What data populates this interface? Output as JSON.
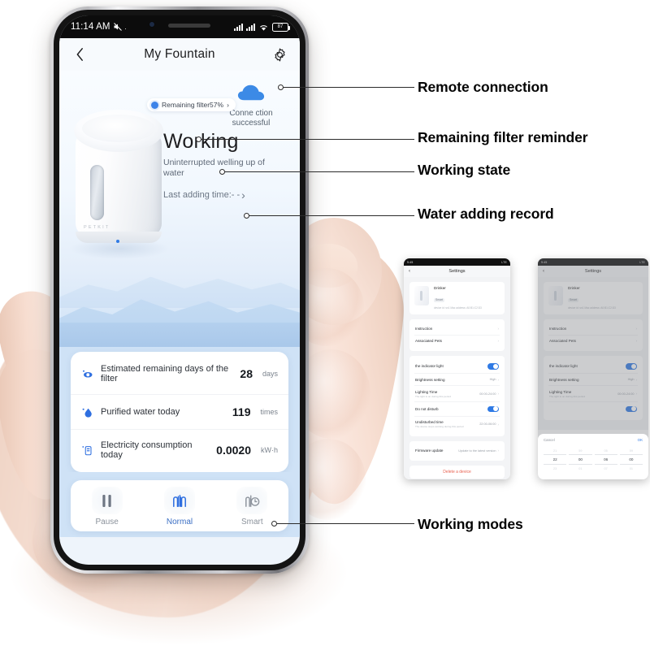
{
  "phone": {
    "status_bar": {
      "time": "11:14 AM",
      "mute_icon": "mute-icon",
      "signal_icon": "signal-bars-icon",
      "wifi_icon": "wifi-icon",
      "battery_label": "87"
    },
    "header": {
      "back_icon": "back-chevron-icon",
      "title": "My Fountain",
      "settings_icon": "gear-icon"
    },
    "hero": {
      "cloud_icon": "cloud-icon",
      "connection_text": "Conne ction successful",
      "device_brand": "PETKIT",
      "filter_pill": "Remaining filter57%",
      "filter_pill_chevron": "›",
      "working_title": "Working",
      "working_sub": "Uninterrupted welling up of water",
      "adding_record": "Last adding time:- -",
      "adding_record_chevron": "›"
    },
    "stats": [
      {
        "icon": "filter-eye-icon",
        "label": "Estimated remaining days of the filter",
        "value": "28",
        "unit": "days"
      },
      {
        "icon": "water-drop-icon",
        "label": "Purified water today",
        "value": "119",
        "unit": "times"
      },
      {
        "icon": "battery-meter-icon",
        "label": "Electricity consumption today",
        "value": "0.0020",
        "unit": "kW·h"
      }
    ],
    "modes": [
      {
        "icon": "pause-icon",
        "label": "Pause",
        "active": false
      },
      {
        "icon": "water-jets-icon",
        "label": "Normal",
        "active": true
      },
      {
        "icon": "smart-clock-icon",
        "label": "Smart",
        "active": false
      }
    ]
  },
  "annotations": [
    {
      "label": "Remote connection"
    },
    {
      "label": "Remaining filter reminder"
    },
    {
      "label": "Working state"
    },
    {
      "label": "Water adding record"
    },
    {
      "label": "Working modes"
    }
  ],
  "mini_screens": [
    {
      "status_left": "9:45",
      "status_right": "LTE",
      "title": "Settings",
      "back": "‹",
      "device": {
        "name": "Drinker",
        "tag": "Smart",
        "desc": "device id:  sn1  Mac address:  A0:B1:C2:D3"
      },
      "nav": [
        {
          "label": "Instruction",
          "value": ""
        },
        {
          "label": "Associated Pets",
          "value": ""
        }
      ],
      "settings": [
        {
          "label": "the indicator light",
          "sub": "",
          "control": "toggle",
          "value": ""
        },
        {
          "label": "Brightness setting",
          "sub": "",
          "control": "text",
          "value": "High"
        },
        {
          "label": "Lighting Time",
          "sub": "The light is on during this period",
          "control": "text",
          "value": "00:00-24:00"
        },
        {
          "label": "Do not disturb",
          "sub": "",
          "control": "toggle",
          "value": ""
        },
        {
          "label": "Undisturbed time",
          "sub": "The device stops working during this period",
          "control": "text",
          "value": "22:00-06:00"
        }
      ],
      "firmware": {
        "label": "Firmware update",
        "value": "Update to the latest version"
      },
      "delete": "Delete a device"
    },
    {
      "status_left": "9:45",
      "status_right": "LTE",
      "title": "Settings",
      "back": "‹",
      "device": {
        "name": "Drinker",
        "tag": "Smart",
        "desc": "device id:  sn1  Mac address:  A0:B1:C2:D3"
      },
      "nav": [
        {
          "label": "Instruction",
          "value": ""
        },
        {
          "label": "Associated Pets",
          "value": ""
        }
      ],
      "settings": [
        {
          "label": "the indicator light",
          "sub": "",
          "control": "toggle",
          "value": ""
        },
        {
          "label": "Brightness setting",
          "sub": "",
          "control": "text",
          "value": "High"
        },
        {
          "label": "Lighting Time",
          "sub": "The light is on during this period",
          "control": "text",
          "value": "00:00-24:00"
        }
      ],
      "picker": {
        "cancel": "Cancel",
        "ok": "OK",
        "columns": [
          {
            "above": "21",
            "selected": "22",
            "below": "23"
          },
          {
            "above": "59",
            "selected": "00",
            "below": "01"
          },
          {
            "above": "05",
            "selected": "06",
            "below": "07"
          },
          {
            "above": "59",
            "selected": "00",
            "below": "01"
          }
        ]
      }
    }
  ]
}
